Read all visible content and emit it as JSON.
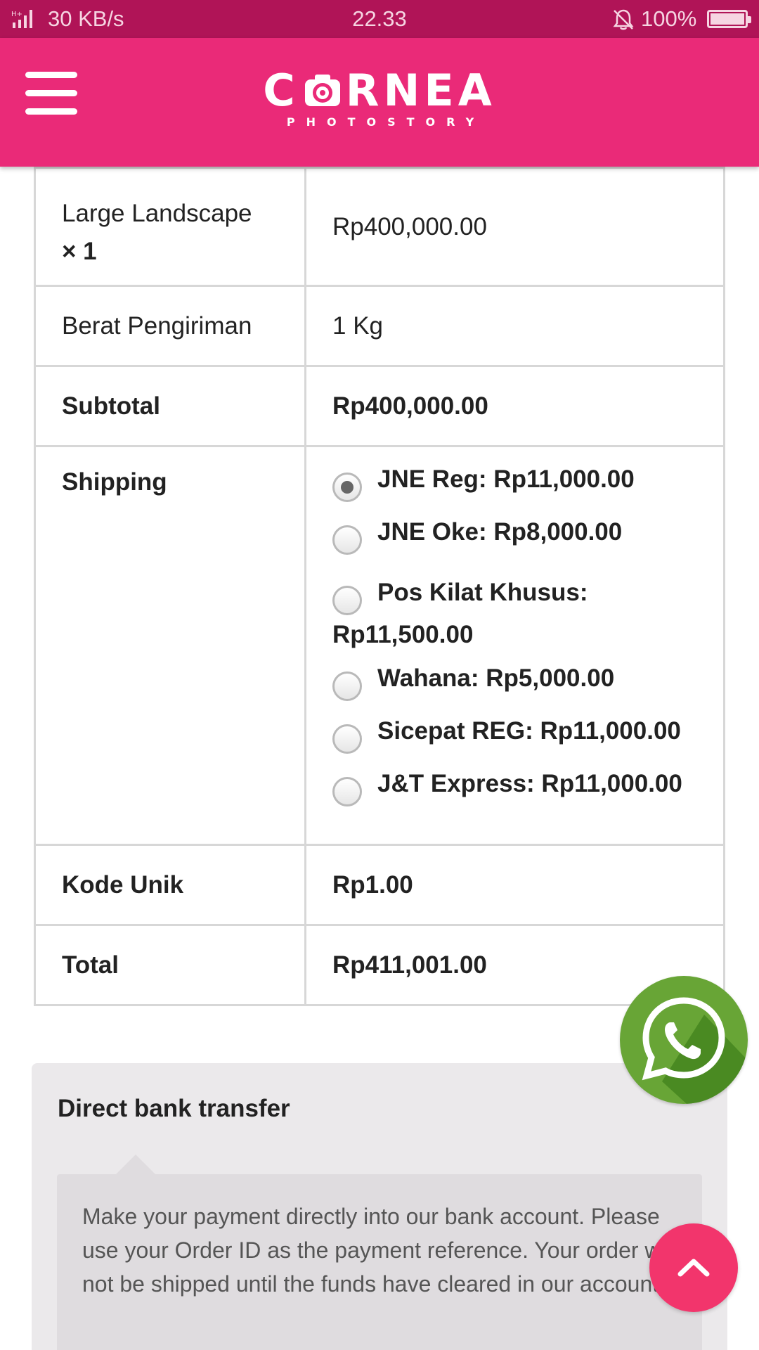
{
  "status_bar": {
    "network_speed": "30 KB/s",
    "time": "22.33",
    "battery": "100%",
    "signal_icon": "signal-icon",
    "bell_icon": "bell-muted-icon",
    "battery_icon": "battery-icon"
  },
  "header": {
    "logo_word_left": "C",
    "logo_word_right": "RNEA",
    "logo_tagline": "PHOTOSTORY",
    "menu_icon": "hamburger-menu-icon",
    "logo_icon": "camera-icon",
    "background_color": "#ea2a78"
  },
  "order_table": {
    "product": {
      "name": "Large Landscape",
      "quantity": "× 1",
      "price": "Rp400,000.00"
    },
    "weight": {
      "label": "Berat Pengiriman",
      "value": "1 Kg"
    },
    "subtotal": {
      "label": "Subtotal",
      "value": "Rp400,000.00"
    },
    "shipping": {
      "label": "Shipping",
      "selected_index": 0,
      "options": [
        {
          "label": "JNE Reg: Rp11,000.00"
        },
        {
          "label": "JNE Oke: Rp8,000.00"
        },
        {
          "label": "Pos Kilat Khusus:",
          "label_cont": "Rp11,500.00"
        },
        {
          "label": "Wahana: Rp5,000.00"
        },
        {
          "label": "Sicepat REG: Rp11,000.00"
        },
        {
          "label": "J&T Express: Rp11,000.00"
        }
      ]
    },
    "unique_code": {
      "label": "Kode Unik",
      "value": "Rp1.00"
    },
    "total": {
      "label": "Total",
      "value": "Rp411,001.00"
    }
  },
  "payment": {
    "method_title": "Direct bank transfer",
    "description": "Make your payment directly into our bank account. Please use your Order ID as the payment reference. Your order will not be shipped until the funds have cleared in our account."
  },
  "floating": {
    "whatsapp_icon": "whatsapp-icon",
    "whatsapp_color": "#68a536",
    "scroll_top_icon": "chevron-up-icon",
    "scroll_top_color": "#f2356c"
  }
}
